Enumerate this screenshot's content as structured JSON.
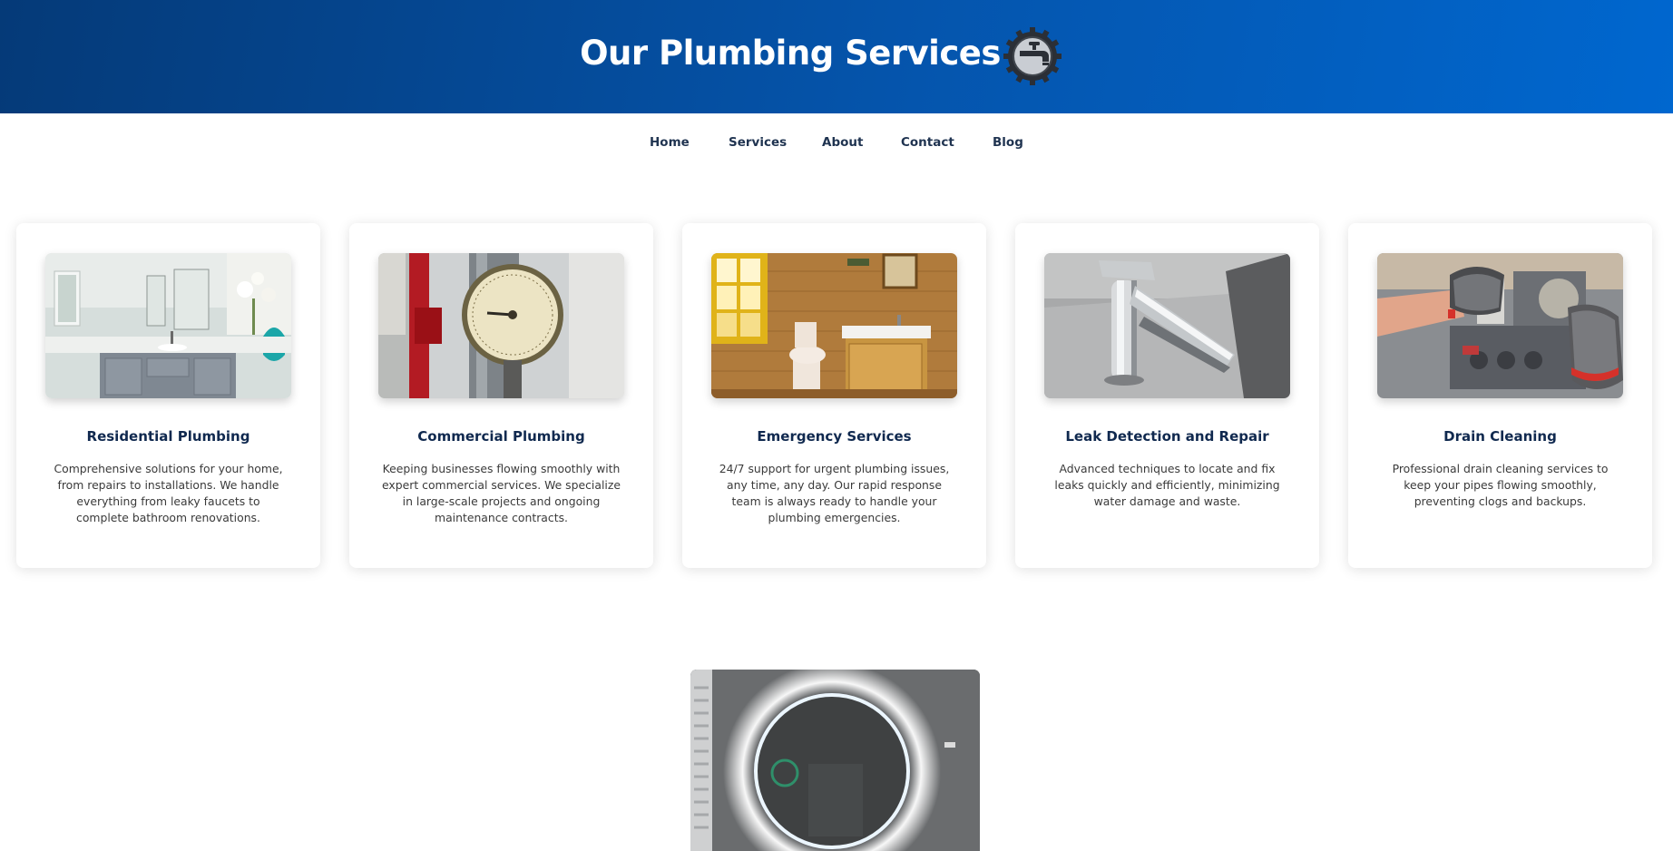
{
  "header": {
    "title": "Our Plumbing Services",
    "logo_icon": "faucet-gear-icon"
  },
  "nav": {
    "items": [
      {
        "label": "Home"
      },
      {
        "label": "Services"
      },
      {
        "label": "About"
      },
      {
        "label": "Contact"
      },
      {
        "label": "Blog"
      }
    ]
  },
  "services": [
    {
      "title": "Residential Plumbing",
      "description": "Comprehensive solutions for your home, from repairs to installations. We handle everything from leaky faucets to complete bathroom renovations.",
      "image": "bathroom-vanity-photo"
    },
    {
      "title": "Commercial Plumbing",
      "description": "Keeping businesses flowing smoothly with expert commercial services. We specialize in large-scale projects and ongoing maintenance contracts.",
      "image": "pressure-gauge-photo"
    },
    {
      "title": "Emergency Services",
      "description": "24/7 support for urgent plumbing issues, any time, any day. Our rapid response team is always ready to handle your plumbing emergencies.",
      "image": "wooden-bathroom-photo"
    },
    {
      "title": "Leak Detection and Repair",
      "description": "Advanced techniques to locate and fix leaks quickly and efficiently, minimizing water damage and waste.",
      "image": "chrome-faucet-photo"
    },
    {
      "title": "Drain Cleaning",
      "description": "Professional drain cleaning services to keep your pipes flowing smoothly, preventing clogs and backups.",
      "image": "gloved-hands-boiler-photo"
    }
  ],
  "featured_image": "backlit-round-mirror-photo",
  "colors": {
    "header_start": "#053a78",
    "header_end": "#0067cf",
    "title_navy": "#10294f",
    "nav_text": "#1f3350"
  }
}
